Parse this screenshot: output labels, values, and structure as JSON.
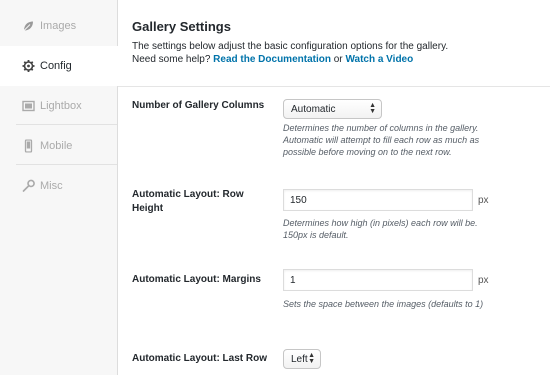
{
  "sidebar": {
    "items": [
      {
        "label": "Images",
        "icon": "leaf-icon"
      },
      {
        "label": "Config",
        "icon": "gear-icon"
      },
      {
        "label": "Lightbox",
        "icon": "lightbox-icon"
      },
      {
        "label": "Mobile",
        "icon": "mobile-icon"
      },
      {
        "label": "Misc",
        "icon": "wrench-icon"
      }
    ],
    "active": "Config"
  },
  "header": {
    "title": "Gallery Settings",
    "description": "The settings below adjust the basic configuration options for the gallery.",
    "help_prefix": "Need some help?",
    "doc_link": "Read the Documentation",
    "or_text": "or",
    "video_link": "Watch a Video"
  },
  "settings": {
    "columns": {
      "label": "Number of Gallery Columns",
      "value": "Automatic",
      "help": "Determines the number of columns in the gallery. Automatic will attempt to fill each row as much as possible before moving on to the next row."
    },
    "row_height": {
      "label": "Automatic Layout: Row Height",
      "value": "150",
      "unit": "px",
      "help": "Determines how high (in pixels) each row will be. 150px is default."
    },
    "margins": {
      "label": "Automatic Layout: Margins",
      "value": "1",
      "unit": "px",
      "help": "Sets the space between the images (defaults to 1)"
    },
    "last_row": {
      "label": "Automatic Layout: Last Row",
      "value": "Left"
    }
  },
  "colors": {
    "link": "#0073aa",
    "sidebar_bg": "#f7f7f7",
    "muted": "#aaaaaa"
  }
}
